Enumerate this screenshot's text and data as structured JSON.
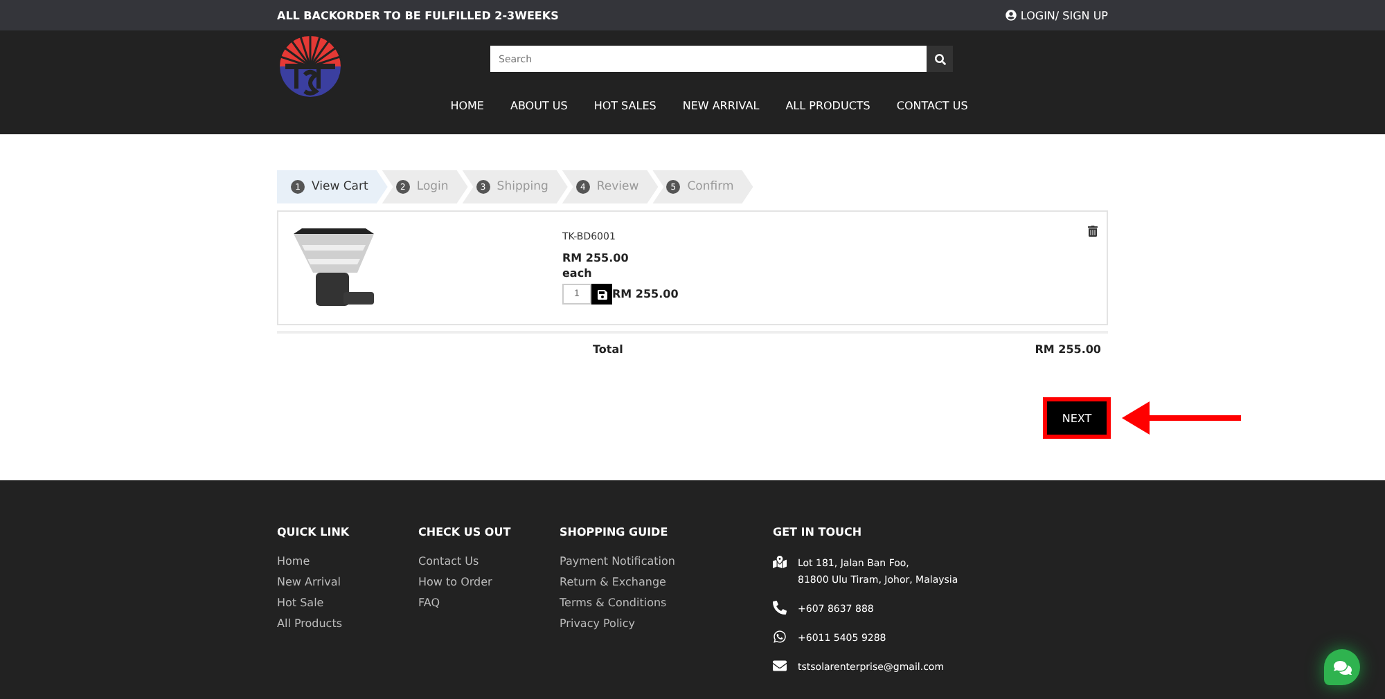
{
  "topbar": {
    "notice": "ALL BACKORDER TO BE FULFILLED 2-3WEEKS",
    "login": "LOGIN/ SIGN UP"
  },
  "search": {
    "placeholder": "Search"
  },
  "nav": [
    "HOME",
    "ABOUT US",
    "HOT SALES",
    "NEW ARRIVAL",
    "ALL PRODUCTS",
    "CONTACT US"
  ],
  "steps": [
    {
      "number": "1",
      "label": "View Cart",
      "selected": true
    },
    {
      "number": "2",
      "label": "Login",
      "selected": false
    },
    {
      "number": "3",
      "label": "Shipping",
      "selected": false
    },
    {
      "number": "4",
      "label": "Review",
      "selected": false
    },
    {
      "number": "5",
      "label": "Confirm",
      "selected": false
    }
  ],
  "cart_item": {
    "kind": "picture",
    "sku": "TK-BD6001",
    "price": "RM 255.00",
    "unit": "each",
    "quantity": "1",
    "subtotal": "RM 255.00"
  },
  "total": {
    "label": "Total",
    "amount": "RM 255.00"
  },
  "next_button": {
    "label": "NEXT",
    "highlighted": true
  },
  "footer": {
    "columns": [
      {
        "title": "QUICK LINK",
        "links": [
          "Home",
          "New Arrival",
          "Hot Sale",
          "All Products"
        ]
      },
      {
        "title": "CHECK US OUT",
        "links": [
          "Contact Us",
          "How to Order",
          "FAQ"
        ]
      },
      {
        "title": "SHOPPING GUIDE",
        "links": [
          "Payment Notification",
          "Return & Exchange",
          "Terms & Conditions",
          "Privacy Policy"
        ]
      }
    ],
    "contact_title": "GET IN TOUCH",
    "contacts": [
      {
        "kind": "address",
        "lines": [
          "Lot 181, Jalan Ban Foo,",
          "81800 Ulu Tiram, Johor, Malaysia"
        ]
      },
      {
        "kind": "phone",
        "lines": [
          "+607 8637 888"
        ]
      },
      {
        "kind": "whatsapp",
        "lines": [
          "+6011 5405 9288"
        ]
      },
      {
        "kind": "email",
        "lines": [
          "tstsolarenterprise@gmail.com"
        ]
      }
    ]
  }
}
